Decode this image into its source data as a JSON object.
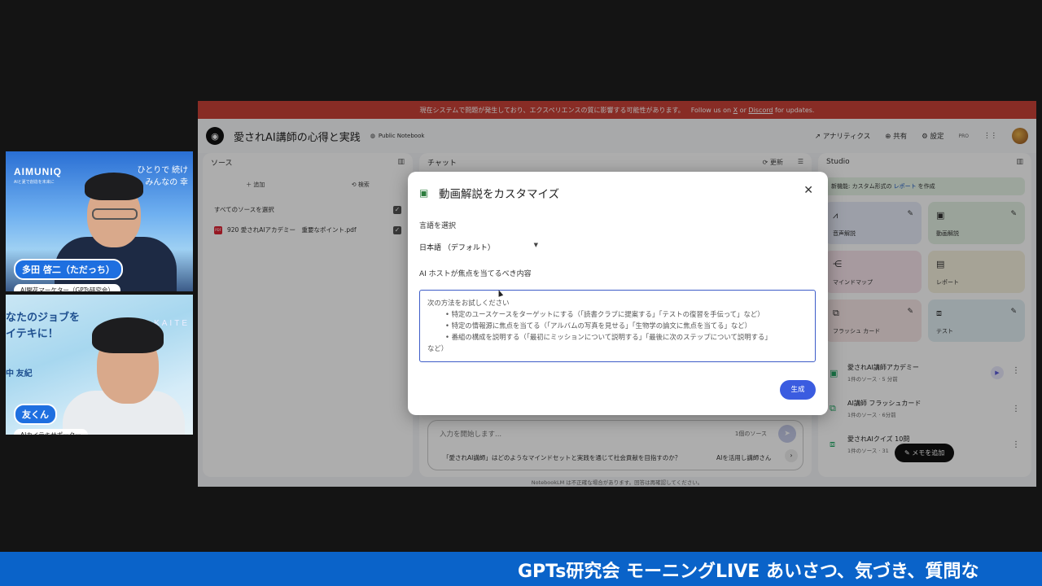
{
  "cams": [
    {
      "brand": "AIMUNIQ",
      "brand_sub": "AIと夏で創造を未来に",
      "slogan_lines": [
        "ひとりで 続け",
        "みんなの 幸"
      ],
      "name": "多田 啓二（ただっち）",
      "role": "AI開花マーケター（GPTs研究会）"
    },
    {
      "headline_lines": [
        "なたのジョブを",
        "イテキに！"
      ],
      "brand": "KAITE",
      "person_name": "中 友紀",
      "name": "友くん",
      "role": "AIカイテキサポーター"
    }
  ],
  "app": {
    "banner_text": "現在システムで問題が発生しており、エクスペリエンスの質に影響する可能性があります。",
    "banner_follow": "Follow us on",
    "banner_x": "X",
    "banner_or": "or",
    "banner_discord": "Discord",
    "banner_updates": "for updates.",
    "notebook_title": "愛されAI講師の心得と実践",
    "public_label": "Public Notebook",
    "topbar": {
      "analytics": "アナリティクス",
      "share": "共有",
      "settings": "設定",
      "pro": "PRO"
    },
    "sources": {
      "title": "ソース",
      "add": "追加",
      "search": "検索",
      "select_all": "すべてのソースを選択",
      "items": [
        {
          "name": "920 愛されAIアカデミー　重要なポイント.pdf"
        }
      ]
    },
    "chat": {
      "title": "チャット",
      "refresh": "更新",
      "input_placeholder": "入力を開始します...",
      "source_count": "1個のソース",
      "suggestion": "「愛されAI講師」はどのようなマインドセットと実践を通じて社会貢献を目指すのか？",
      "suggestion2": "AIを活用し講師さん"
    },
    "studio": {
      "title": "Studio",
      "notice_prefix": "新機能: カスタム形式の",
      "notice_link": "レポート",
      "notice_suffix": "を作成",
      "tiles": [
        {
          "label": "音声解説",
          "icon": "waveform-icon",
          "color": "blue"
        },
        {
          "label": "動画解説",
          "icon": "video-icon",
          "color": "green"
        },
        {
          "label": "マインドマップ",
          "icon": "mindmap-icon",
          "color": "pink"
        },
        {
          "label": "レポート",
          "icon": "report-icon",
          "color": "yellow"
        },
        {
          "label": "フラッシュ カード",
          "icon": "flashcard-icon",
          "color": "rose"
        },
        {
          "label": "テスト",
          "icon": "quiz-icon",
          "color": "cyan"
        }
      ],
      "notes": [
        {
          "title": "愛されAI講師アカデミー",
          "sub": "1件のソース · 5 分前"
        },
        {
          "title": "AI講師 フラッシュカード",
          "sub": "1件のソース · 6分前"
        },
        {
          "title": "愛されAIクイズ 10問",
          "sub": "1件のソース · 31"
        }
      ],
      "memo_button": "メモを追加"
    },
    "footnote": "NotebookLM は不正確な場合があります。回答は再確認してください。"
  },
  "modal": {
    "title": "動画解説をカスタマイズ",
    "language_label": "言語を選択",
    "language_value": "日本語 （デフォルト）",
    "focus_label": "AI ホストが焦点を当てるべき内容",
    "placeholder_intro": "次の方法をお試しください",
    "placeholder_bullets": [
      "• 特定のユースケースをターゲットにする（「読書クラブに提案する」「テストの復習を手伝って」など）",
      "• 特定の情報源に焦点を当てる（「アルバムの写真を見せる」「生物学の論文に焦点を当てる」など）",
      "• 番組の構成を説明する（「最初にミッションについて説明する」「最後に次のステップについて説明する」"
    ],
    "placeholder_tail": "など）",
    "generate_button": "生成"
  },
  "ticker": "GPTs研究会 モーニングLIVE あいさつ、気づき、質問な"
}
